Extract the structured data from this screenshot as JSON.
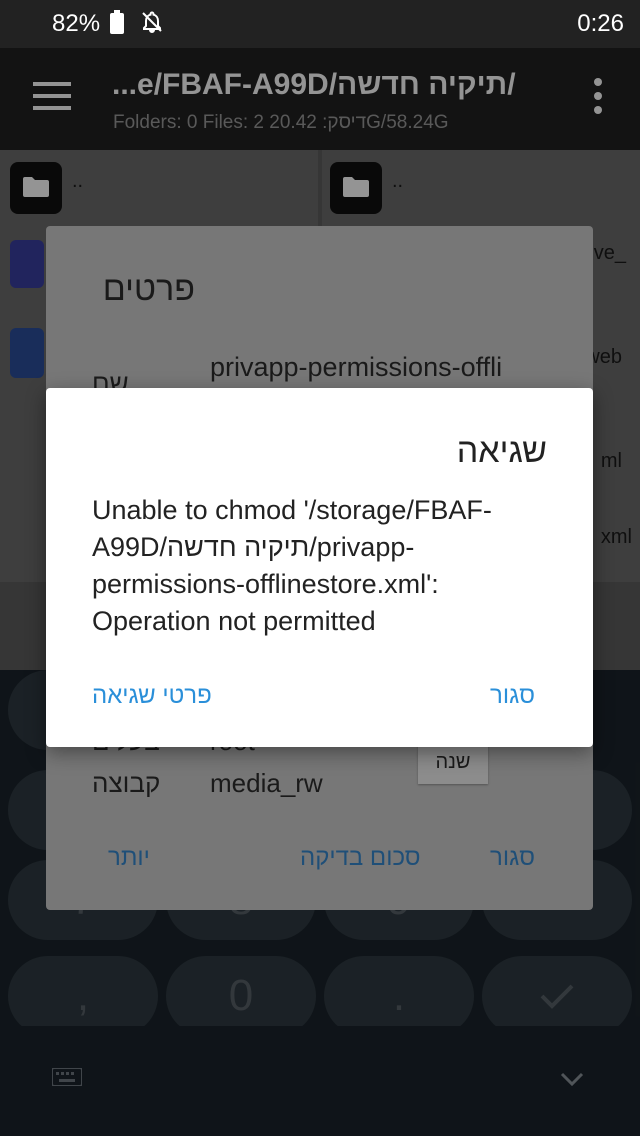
{
  "status_bar": {
    "battery": "82%",
    "time": "0:26"
  },
  "app_bar": {
    "path": "...e/FBAF-A99D/תיקיה חדשה/",
    "subtitle": "Folders: 0  Files: 2  20.42 :דיסקG/58.24G"
  },
  "left_pane": {
    "up_label": ".."
  },
  "right_pane": {
    "up_label": "..",
    "peek_items": [
      "ve_",
      "web",
      "ml",
      "xml"
    ]
  },
  "details_dialog": {
    "title": "פרטים",
    "name_label": "שם",
    "name_value": "privapp-permissions-offli",
    "owner_label": "בעלים",
    "owner_value": "root",
    "group_label": "קבוצה",
    "group_value": "media_rw",
    "change_label": "שנה",
    "buttons": {
      "more": "יותר",
      "checksum": "סכום בדיקה",
      "close": "סגור"
    }
  },
  "error_dialog": {
    "title": "שגיאה",
    "message": "Unable to chmod '/storage/FBAF-A99D/תיקיה חדשה/privapp-permissions-offlinestore.xml': Operation not permitted",
    "buttons": {
      "details": "פרטי שגיאה",
      "close": "סגור"
    }
  },
  "keyboard": {
    "visible_keys": [
      "7",
      "8",
      "9",
      ",",
      "0",
      "."
    ]
  }
}
